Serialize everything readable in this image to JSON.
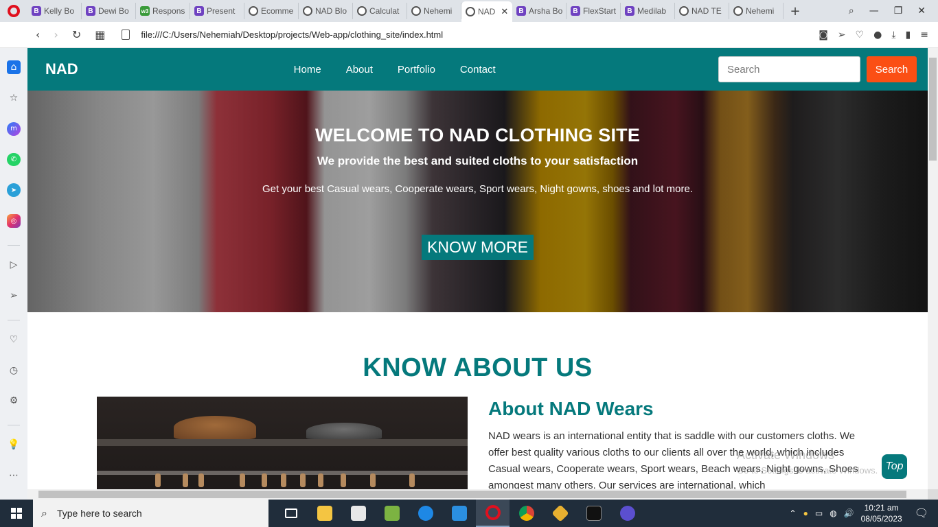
{
  "browser": {
    "tabs": [
      {
        "label": "Kelly Bo",
        "icon": "bootstrap-icon"
      },
      {
        "label": "Dewi Bo",
        "icon": "bootstrap-icon"
      },
      {
        "label": "Respons",
        "icon": "w3schools-icon"
      },
      {
        "label": "Present",
        "icon": "bootstrap-icon"
      },
      {
        "label": "Ecomme",
        "icon": "globe-icon"
      },
      {
        "label": "NAD Blo",
        "icon": "globe-icon"
      },
      {
        "label": "Calculat",
        "icon": "globe-icon"
      },
      {
        "label": "Nehemi",
        "icon": "globe-icon"
      },
      {
        "label": "NAD",
        "icon": "globe-icon",
        "active": true
      },
      {
        "label": "Arsha Bo",
        "icon": "bootstrap-icon"
      },
      {
        "label": "FlexStart",
        "icon": "bootstrap-icon"
      },
      {
        "label": "Medilab",
        "icon": "bootstrap-icon"
      },
      {
        "label": "NAD TE",
        "icon": "globe-icon"
      },
      {
        "label": "Nehemi",
        "icon": "globe-icon"
      }
    ],
    "url": "file:///C:/Users/Nehemiah/Desktop/projects/Web-app/clothing_site/index.html"
  },
  "site": {
    "brand": "NAD",
    "nav": {
      "home": "Home",
      "about": "About",
      "portfolio": "Portfolio",
      "contact": "Contact"
    },
    "search": {
      "placeholder": "Search",
      "button": "Search"
    },
    "hero": {
      "title": "WELCOME TO NAD CLOTHING SITE",
      "subtitle": "We provide the best and suited cloths to your satisfaction",
      "text": "Get your best Casual wears, Cooperate wears, Sport wears, Night gowns, shoes and lot more.",
      "cta": "KNOW MORE"
    },
    "about": {
      "section_title": "KNOW ABOUT US",
      "heading": "About NAD Wears",
      "body": "NAD wears is an international entity that is saddle with our customers cloths. We offer best quality various cloths to our clients all over the world, which includes Casual wears, Cooperate wears, Sport wears, Beach wears, Night gowns, Shoes amongest many others. Our services are international, which"
    },
    "top_button": "Top",
    "colors": {
      "primary": "#05797c",
      "accent": "#fb4f14"
    }
  },
  "watermark": {
    "line1": "Activate Windows",
    "line2": "Go to Settings to activate Windows."
  },
  "taskbar": {
    "search_placeholder": "Type here to search",
    "time": "10:21 am",
    "date": "08/05/2023"
  }
}
